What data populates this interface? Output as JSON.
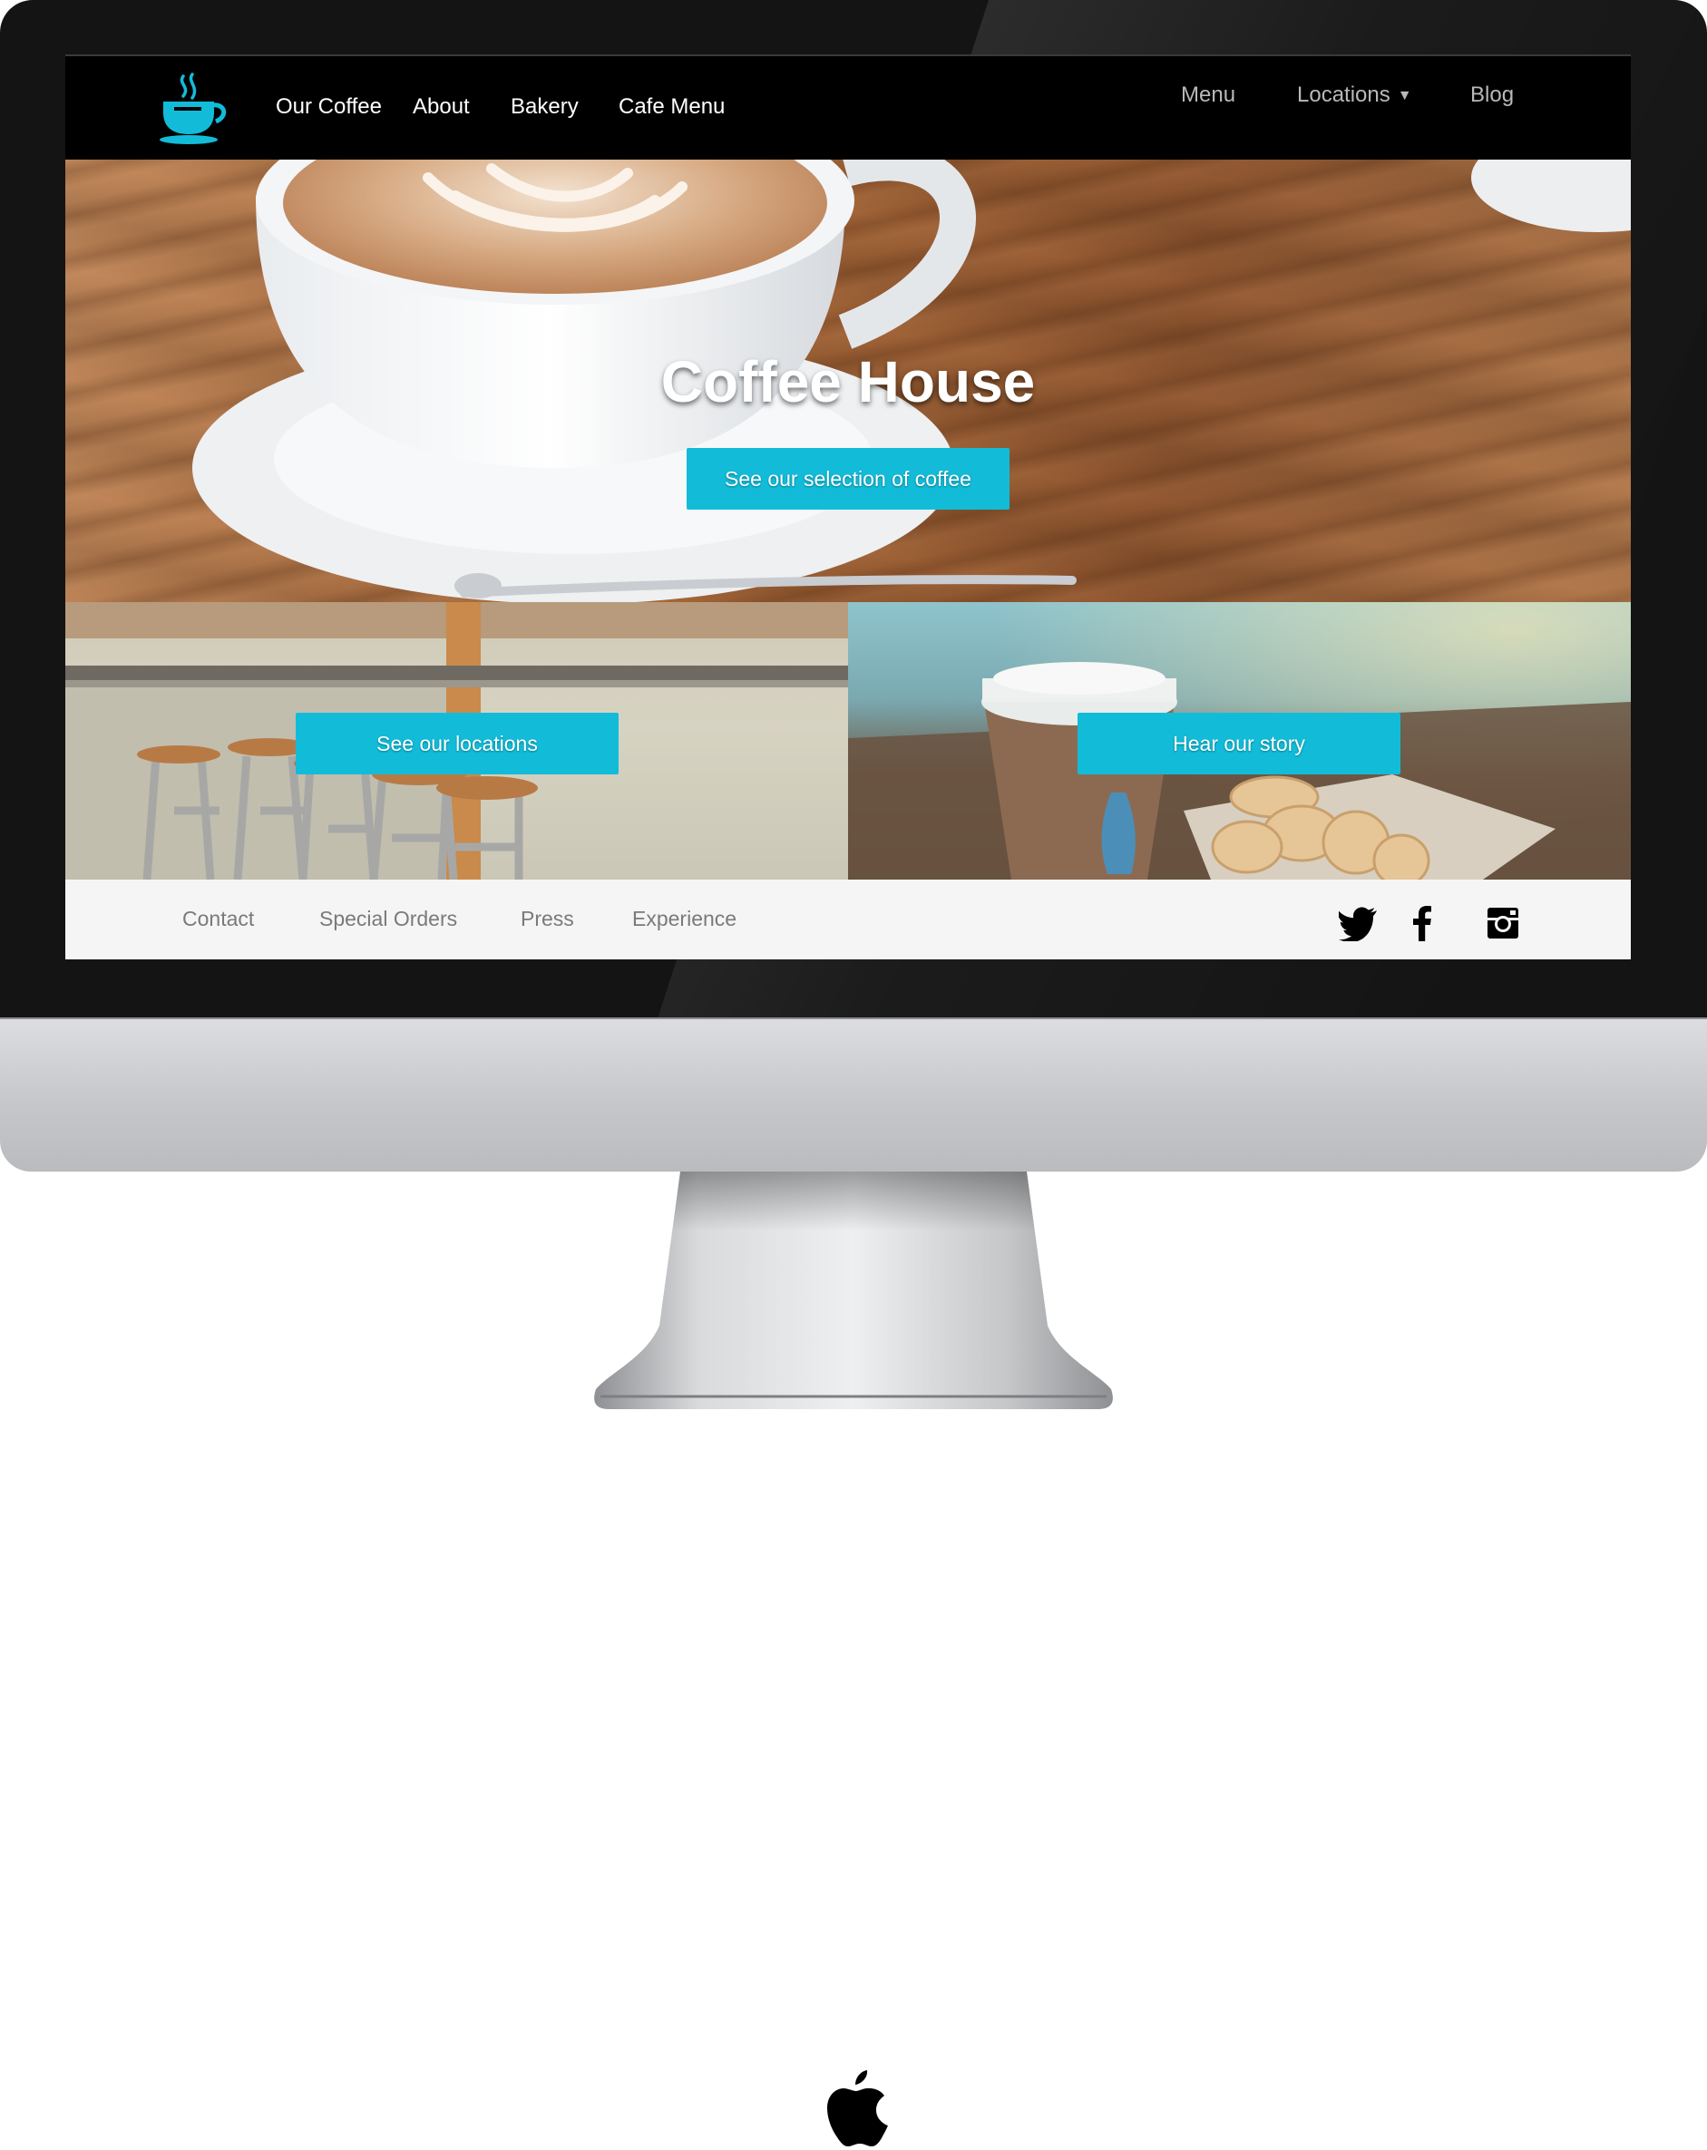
{
  "nav": {
    "primary": [
      "Our Coffee",
      "About",
      "Bakery",
      "Cafe Menu"
    ],
    "secondary": {
      "menu": "Menu",
      "locations": "Locations",
      "blog": "Blog"
    }
  },
  "hero": {
    "title": "Coffee House",
    "cta": "See our selection of coffee"
  },
  "tiles": {
    "locations_cta": "See our locations",
    "story_cta": "Hear our story"
  },
  "footer": {
    "links": [
      "Contact",
      "Special Orders",
      "Press",
      "Experience"
    ],
    "social": [
      "twitter-icon",
      "facebook-icon",
      "instagram-icon"
    ]
  },
  "colors": {
    "accent": "#12bcd9",
    "nav_bg": "#000000",
    "footer_bg": "#f5f5f5"
  }
}
